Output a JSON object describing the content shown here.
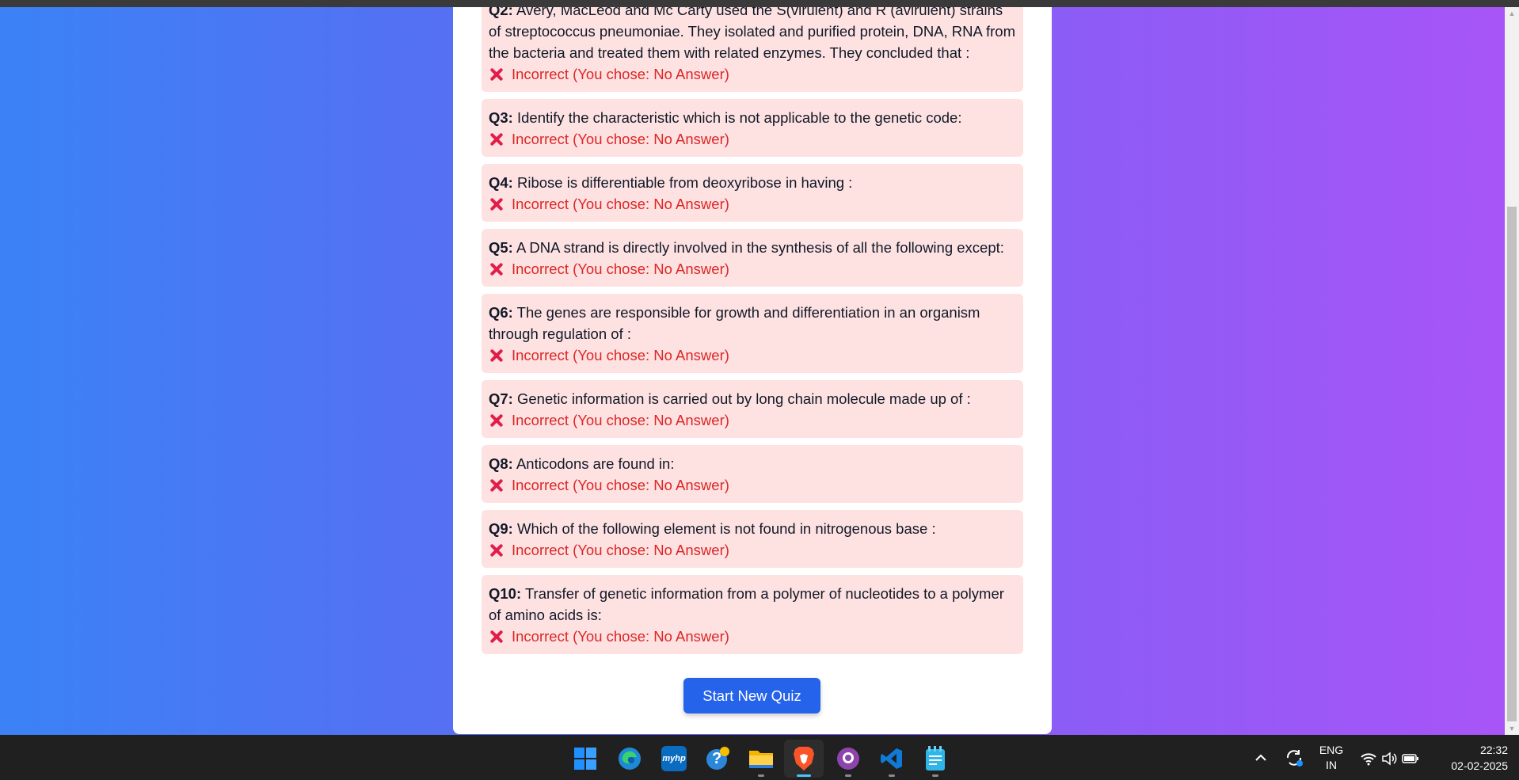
{
  "quiz": {
    "questions": [
      {
        "num": "Q2:",
        "text": " Avery, MacLeod and Mc Carty used the S(virulent) and R (avirulent) strains of streptococcus pneumoniae. They isolated and purified protein, DNA, RNA from the bacteria and treated them with related enzymes. They concluded that :",
        "result": "Incorrect (You chose: No Answer)"
      },
      {
        "num": "Q3:",
        "text": " Identify the characteristic which is not applicable to the genetic code:",
        "result": "Incorrect (You chose: No Answer)"
      },
      {
        "num": "Q4:",
        "text": " Ribose is differentiable from deoxyribose in having :",
        "result": "Incorrect (You chose: No Answer)"
      },
      {
        "num": "Q5:",
        "text": " A DNA strand is directly involved in the synthesis of all the following except:",
        "result": "Incorrect (You chose: No Answer)"
      },
      {
        "num": "Q6:",
        "text": " The genes are responsible for growth and differentiation in an organism through regulation of :",
        "result": "Incorrect (You chose: No Answer)"
      },
      {
        "num": "Q7:",
        "text": " Genetic information is carried out by long chain molecule made up of :",
        "result": "Incorrect (You chose: No Answer)"
      },
      {
        "num": "Q8:",
        "text": " Anticodons are found in:",
        "result": "Incorrect (You chose: No Answer)"
      },
      {
        "num": "Q9:",
        "text": " Which of the following element is not found in nitrogenous base :",
        "result": "Incorrect (You chose: No Answer)"
      },
      {
        "num": "Q10:",
        "text": " Transfer of genetic information from a polymer of nucleotides to a polymer of amino acids is:",
        "result": "Incorrect (You chose: No Answer)"
      }
    ],
    "start_button_label": "Start New Quiz"
  },
  "colors": {
    "gradient_start": "#3b82f6",
    "gradient_end": "#a855f7",
    "incorrect_bg": "#fee2e2",
    "incorrect_text": "#dc2626",
    "button": "#2563eb"
  },
  "taskbar": {
    "apps": [
      "windows-start-icon",
      "edge-icon",
      "myhp-icon",
      "help-icon",
      "file-explorer-icon",
      "brave-icon",
      "github-desktop-icon",
      "vscode-icon",
      "notepad-icon"
    ],
    "myhp_label": "myhp",
    "help_label": "?",
    "language_line1": "ENG",
    "language_line2": "IN",
    "time": "22:32",
    "date": "02-02-2025"
  }
}
